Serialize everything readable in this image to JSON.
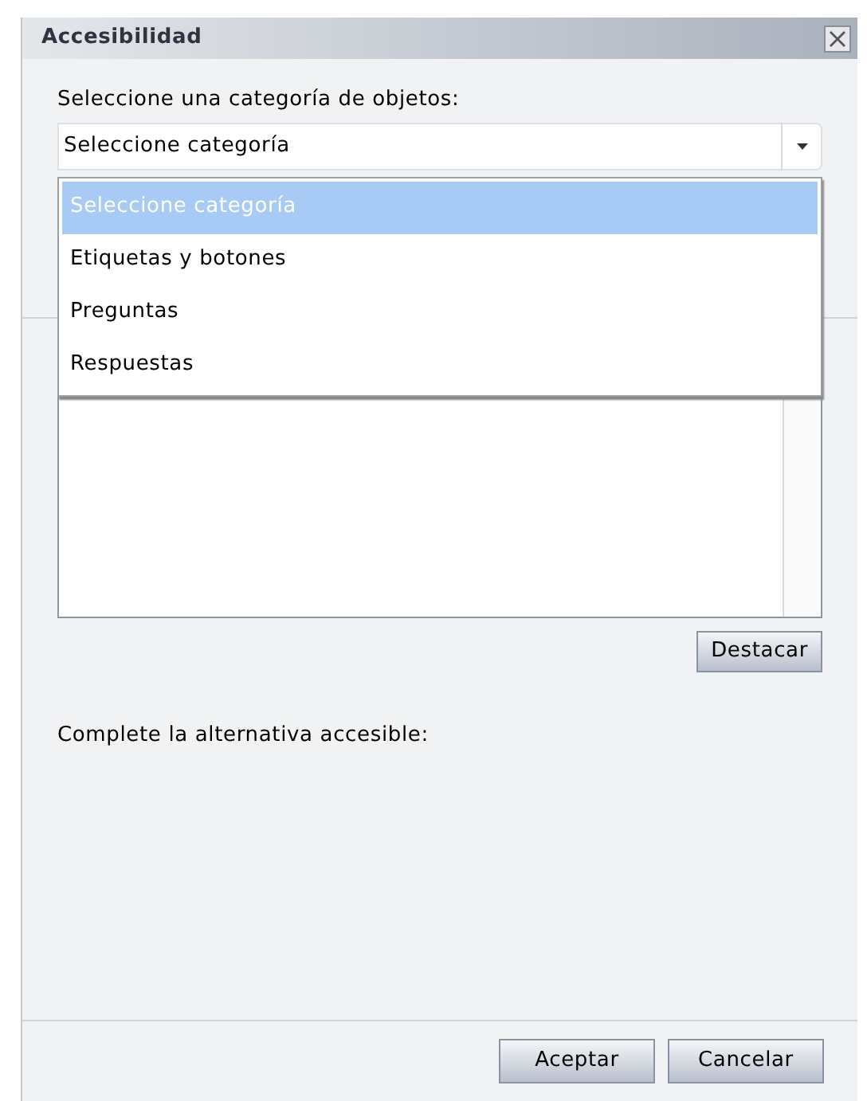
{
  "window": {
    "title": "Accesibilidad"
  },
  "category_label": "Seleccione una categoría de objetos:",
  "category_select": {
    "value": "Seleccione categoría",
    "expanded": true,
    "options": [
      {
        "label": "Seleccione categoría",
        "selected": true
      },
      {
        "label": "Etiquetas y botones",
        "selected": false
      },
      {
        "label": "Preguntas",
        "selected": false
      },
      {
        "label": "Respuestas",
        "selected": false
      }
    ]
  },
  "highlight_button": "Destacar",
  "alternative_label": "Complete la alternativa accesible:",
  "buttons": [
    "Aceptar",
    "Cancelar"
  ]
}
